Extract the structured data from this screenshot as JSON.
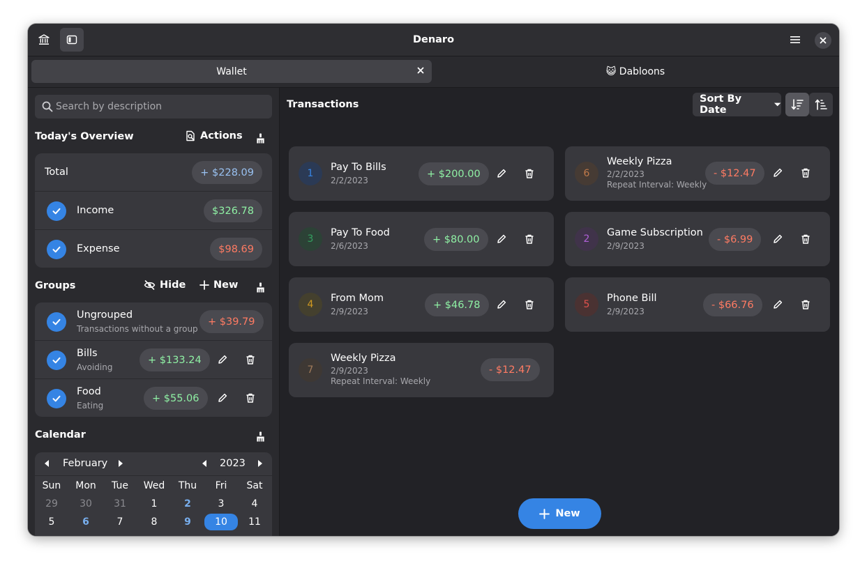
{
  "window": {
    "title": "Denaro"
  },
  "tabs": [
    {
      "label": "Wallet",
      "active": true
    },
    {
      "label": "😺 Dabloons",
      "active": false
    }
  ],
  "sidebar": {
    "search_placeholder": "Search by description",
    "overview": {
      "title": "Today's Overview",
      "actions_label": "Actions",
      "total": {
        "label": "Total",
        "value": "+ $228.09"
      },
      "income": {
        "label": "Income",
        "value": "$326.78"
      },
      "expense": {
        "label": "Expense",
        "value": "$98.69"
      }
    },
    "groups": {
      "title": "Groups",
      "hide_label": "Hide",
      "new_label": "New",
      "items": [
        {
          "name": "Ungrouped",
          "description": "Transactions without a group",
          "amount": "+  $39.79"
        },
        {
          "name": "Bills",
          "description": "Avoiding",
          "amount": "+  $133.24"
        },
        {
          "name": "Food",
          "description": "Eating",
          "amount": "+  $55.06"
        }
      ]
    },
    "calendar": {
      "title": "Calendar",
      "month": "February",
      "year": "2023",
      "weekdays": [
        "Sun",
        "Mon",
        "Tue",
        "Wed",
        "Thu",
        "Fri",
        "Sat"
      ],
      "week1": [
        "29",
        "30",
        "31",
        "1",
        "2",
        "3",
        "4"
      ],
      "week2": [
        "5",
        "6",
        "7",
        "8",
        "9",
        "10",
        "11"
      ]
    }
  },
  "main": {
    "title": "Transactions",
    "sort_label": "Sort By Date",
    "new_label": "New",
    "transactions": [
      {
        "id": "1",
        "name": "Pay To Bills",
        "date": "2/2/2023",
        "amount": "+  $200.00",
        "repeat": "",
        "color": "#3584e4"
      },
      {
        "id": "6",
        "name": "Weekly Pizza",
        "date": "2/2/2023",
        "amount": "-  $12.47",
        "repeat": "Repeat Interval: Weekly",
        "color": "#c07a4a"
      },
      {
        "id": "3",
        "name": "Pay To Food",
        "date": "2/6/2023",
        "amount": "+  $80.00",
        "repeat": "",
        "color": "#33a060"
      },
      {
        "id": "2",
        "name": "Game Subscription",
        "date": "2/9/2023",
        "amount": "-  $6.99",
        "repeat": "",
        "color": "#b061d8"
      },
      {
        "id": "4",
        "name": "From Mom",
        "date": "2/9/2023",
        "amount": "+  $46.78",
        "repeat": "",
        "color": "#d19a20"
      },
      {
        "id": "5",
        "name": "Phone Bill",
        "date": "2/9/2023",
        "amount": "-  $66.76",
        "repeat": "",
        "color": "#e0524d"
      },
      {
        "id": "7",
        "name": "Weekly Pizza",
        "date": "2/9/2023",
        "amount": "-  $12.47",
        "repeat": "Repeat Interval: Weekly",
        "color": "#a07a5a"
      }
    ]
  },
  "colors": {
    "accent": "#3584e4",
    "income": "#8ff0a4",
    "expense": "#ff7b63",
    "total": "#99c1f1"
  }
}
